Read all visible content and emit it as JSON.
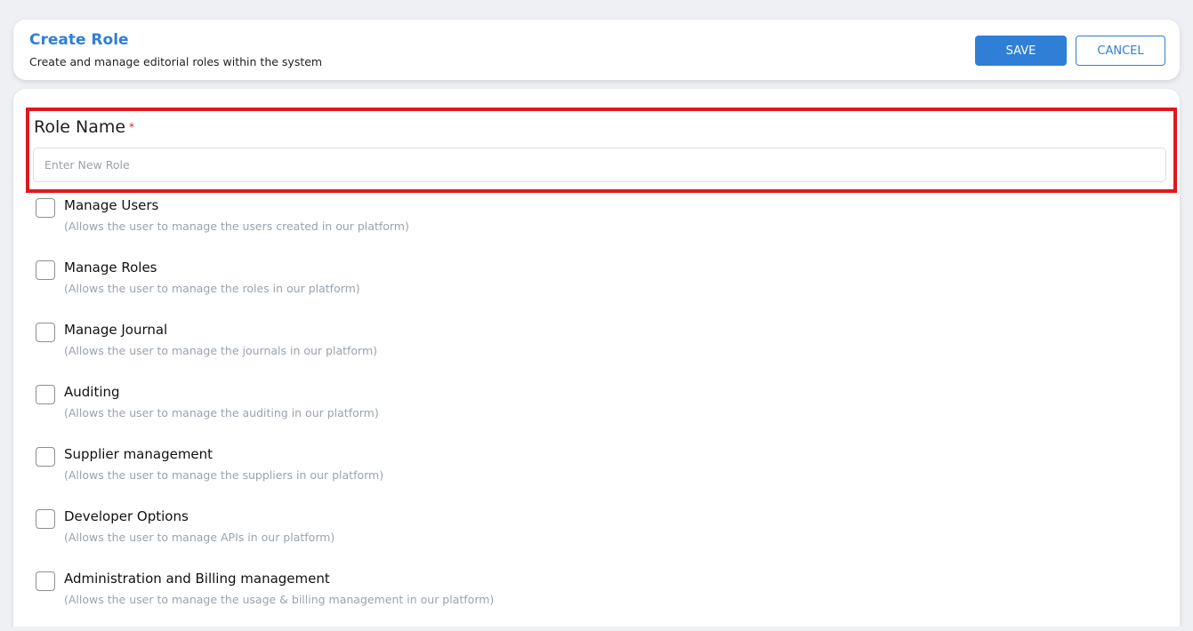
{
  "header": {
    "title": "Create Role",
    "subtitle": "Create and manage editorial roles within the system",
    "save_label": "SAVE",
    "cancel_label": "CANCEL"
  },
  "form": {
    "role_name_label": "Role Name",
    "required_marker": "*",
    "role_name_placeholder": "Enter New Role",
    "role_name_value": ""
  },
  "permissions": [
    {
      "title": "Manage Users",
      "description": "(Allows the user to manage the users created in our platform)",
      "checked": false
    },
    {
      "title": "Manage Roles",
      "description": "(Allows the user to manage the roles in our platform)",
      "checked": false
    },
    {
      "title": "Manage Journal",
      "description": "(Allows the user to manage the journals in our platform)",
      "checked": false
    },
    {
      "title": "Auditing",
      "description": "(Allows the user to manage the auditing in our platform)",
      "checked": false
    },
    {
      "title": "Supplier management",
      "description": "(Allows the user to manage the suppliers in our platform)",
      "checked": false
    },
    {
      "title": "Developer Options",
      "description": "(Allows the user to manage APIs in our platform)",
      "checked": false
    },
    {
      "title": "Administration and Billing management",
      "description": "(Allows the user to manage the usage & billing management in our platform)",
      "checked": false
    }
  ],
  "colors": {
    "accent": "#2f7fd6",
    "highlight_border": "#e0181e",
    "description_text": "#9aa3ad"
  }
}
